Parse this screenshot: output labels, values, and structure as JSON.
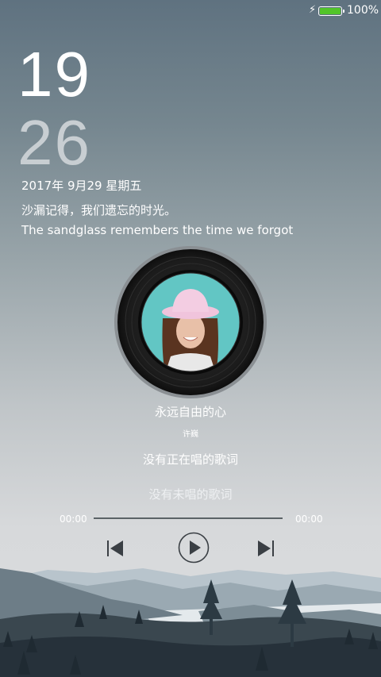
{
  "status_bar": {
    "battery_text": "100%",
    "battery_level": 1.0
  },
  "clock": {
    "hour": "19",
    "minute": "26"
  },
  "date": "2017年 9月29  星期五",
  "quote": {
    "chinese": "沙漏记得，我们遗忘的时光。",
    "english": "The sandglass remembers the time we forgot"
  },
  "player": {
    "song_title": "永远自由的心",
    "artist": "许巍",
    "lyric_current": "没有正在唱的歌词",
    "lyric_next": "没有未唱的歌词",
    "time_elapsed": "00:00",
    "time_total": "00:00",
    "progress": 0
  },
  "icons": {
    "prev": "skip-previous-icon",
    "play": "play-icon",
    "next": "skip-next-icon",
    "charging": "lightning-bolt-icon",
    "battery": "battery-icon"
  },
  "colors": {
    "battery_fill": "#52c42a",
    "minute": "#c8ced2"
  }
}
